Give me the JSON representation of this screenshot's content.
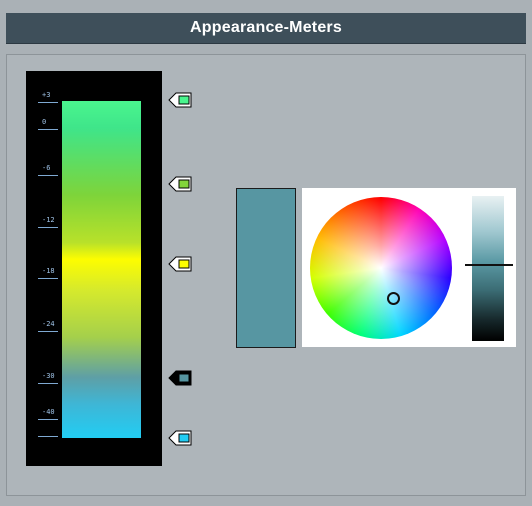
{
  "window": {
    "title": "Appearance-Meters"
  },
  "meter": {
    "scale_labels": [
      "+3",
      "0",
      "-6",
      "-12",
      "-18",
      "-24",
      "-30",
      "-40"
    ],
    "gradient_colors": [
      "#4af58e",
      "#7ed43a",
      "#fdfd00",
      "#a5d04b",
      "#5e9fa6",
      "#22cdf3"
    ]
  },
  "markers": [
    {
      "name": "marker-top",
      "color": "#4af58e",
      "selected": false
    },
    {
      "name": "marker-green",
      "color": "#82d43a",
      "selected": false
    },
    {
      "name": "marker-yellow",
      "color": "#fdfd00",
      "selected": false
    },
    {
      "name": "marker-teal",
      "color": "#5796a2",
      "selected": true
    },
    {
      "name": "marker-cyan",
      "color": "#22cdf3",
      "selected": false
    }
  ],
  "color_editor": {
    "current_color": "#5796a2",
    "brightness_level": 0.53
  }
}
